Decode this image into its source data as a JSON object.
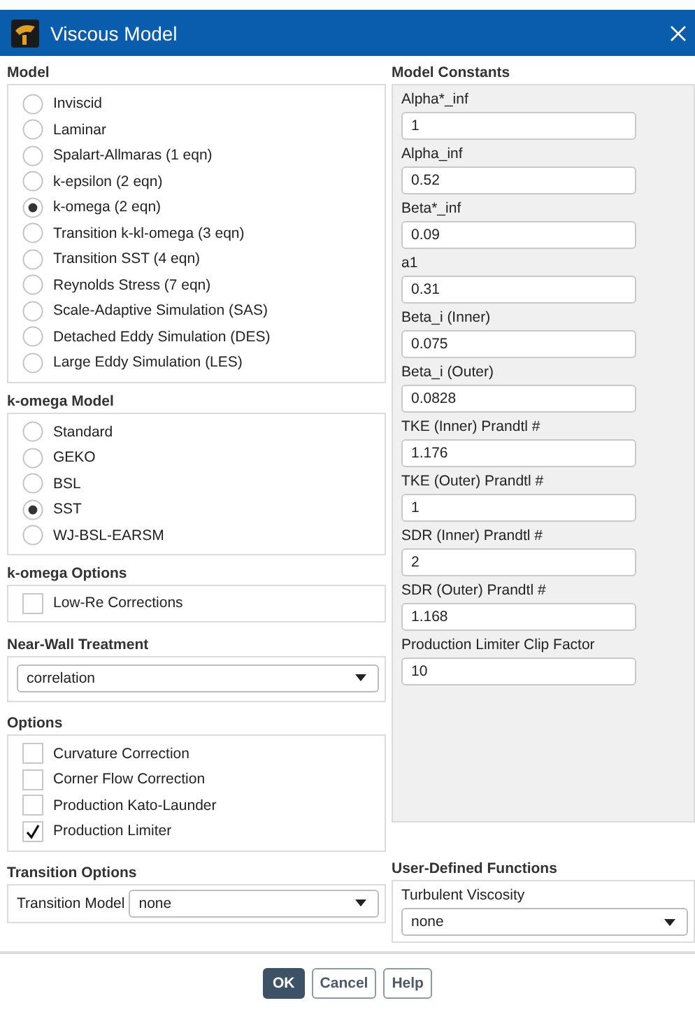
{
  "window": {
    "title": "Viscous Model"
  },
  "model": {
    "title": "Model",
    "options": [
      {
        "label": "Inviscid",
        "selected": false
      },
      {
        "label": "Laminar",
        "selected": false
      },
      {
        "label": "Spalart-Allmaras (1 eqn)",
        "selected": false
      },
      {
        "label": "k-epsilon (2 eqn)",
        "selected": false
      },
      {
        "label": "k-omega (2 eqn)",
        "selected": true
      },
      {
        "label": "Transition k-kl-omega (3 eqn)",
        "selected": false
      },
      {
        "label": "Transition SST (4 eqn)",
        "selected": false
      },
      {
        "label": "Reynolds Stress (7 eqn)",
        "selected": false
      },
      {
        "label": "Scale-Adaptive Simulation (SAS)",
        "selected": false
      },
      {
        "label": "Detached Eddy Simulation (DES)",
        "selected": false
      },
      {
        "label": "Large Eddy Simulation (LES)",
        "selected": false
      }
    ]
  },
  "k_omega_model": {
    "title": "k-omega Model",
    "options": [
      {
        "label": "Standard",
        "selected": false
      },
      {
        "label": "GEKO",
        "selected": false
      },
      {
        "label": "BSL",
        "selected": false
      },
      {
        "label": "SST",
        "selected": true
      },
      {
        "label": "WJ-BSL-EARSM",
        "selected": false
      }
    ]
  },
  "k_omega_options": {
    "title": "k-omega Options",
    "items": [
      {
        "label": "Low-Re Corrections",
        "checked": false
      }
    ]
  },
  "near_wall_treatment": {
    "title": "Near-Wall Treatment",
    "value": "correlation"
  },
  "options": {
    "title": "Options",
    "items": [
      {
        "label": "Curvature Correction",
        "checked": false
      },
      {
        "label": "Corner Flow Correction",
        "checked": false
      },
      {
        "label": "Production Kato-Launder",
        "checked": false
      },
      {
        "label": "Production Limiter",
        "checked": true
      }
    ]
  },
  "transition_options": {
    "title": "Transition Options",
    "label": "Transition Model",
    "value": "none"
  },
  "model_constants": {
    "title": "Model Constants",
    "fields": [
      {
        "label": "Alpha*_inf",
        "value": "1"
      },
      {
        "label": "Alpha_inf",
        "value": "0.52"
      },
      {
        "label": "Beta*_inf",
        "value": "0.09"
      },
      {
        "label": "a1",
        "value": "0.31"
      },
      {
        "label": "Beta_i (Inner)",
        "value": "0.075"
      },
      {
        "label": "Beta_i (Outer)",
        "value": "0.0828"
      },
      {
        "label": "TKE (Inner) Prandtl #",
        "value": "1.176"
      },
      {
        "label": "TKE (Outer) Prandtl #",
        "value": "1"
      },
      {
        "label": "SDR (Inner) Prandtl #",
        "value": "2"
      },
      {
        "label": "SDR (Outer) Prandtl #",
        "value": "1.168"
      },
      {
        "label": "Production Limiter Clip Factor",
        "value": "10"
      }
    ]
  },
  "user_defined_functions": {
    "title": "User-Defined Functions",
    "label": "Turbulent Viscosity",
    "value": "none"
  },
  "buttons": [
    {
      "label": "OK",
      "kind": "primary"
    },
    {
      "label": "Cancel",
      "kind": "default"
    },
    {
      "label": "Help",
      "kind": "default"
    }
  ]
}
